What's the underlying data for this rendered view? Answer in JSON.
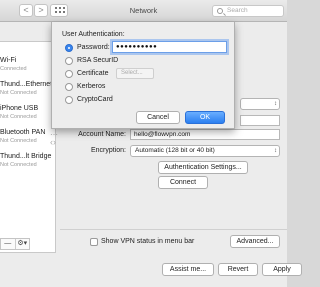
{
  "window": {
    "title": "Network",
    "search_placeholder": "Search",
    "back_glyph": "<",
    "forward_glyph": ">"
  },
  "services": [
    {
      "name": "Wi-Fi",
      "status": "Connected"
    },
    {
      "name": "Thund...Ethernet",
      "status": "Not Connected"
    },
    {
      "name": "iPhone USB",
      "status": "Not Connected"
    },
    {
      "name": "Bluetooth PAN",
      "status": "Not Connected"
    },
    {
      "name": "Thund...lt Bridge",
      "status": "Not Connected"
    }
  ],
  "sidebar_tools": {
    "remove": "—",
    "gear": "⚙▾"
  },
  "form": {
    "account_label": "Account Name:",
    "account_value": "hello@flowvpn.com",
    "encryption_label": "Encryption:",
    "encryption_value": "Automatic (128 bit or 40 bit)",
    "auth_settings": "Authentication Settings...",
    "connect": "Connect",
    "show_vpn": "Show VPN status in menu bar",
    "advanced": "Advanced...",
    "help": "?"
  },
  "footer": {
    "assist": "Assist me...",
    "revert": "Revert",
    "apply": "Apply"
  },
  "sheet": {
    "title": "User Authentication:",
    "options": [
      "Password:",
      "RSA SecurID",
      "Certificate",
      "Kerberos",
      "CryptoCard"
    ],
    "selected_index": 0,
    "password_mask": "●●●●●●●●●●",
    "select_button": "Select...",
    "cancel": "Cancel",
    "ok": "OK"
  },
  "colors": {
    "accent": "#3a86ee",
    "ok_button": "#2b7ff0"
  },
  "icons": [
    "search-icon",
    "grid-icon",
    "gear-icon",
    "dots-icon",
    "arrows-icon",
    "chevron-updown-icon"
  ]
}
